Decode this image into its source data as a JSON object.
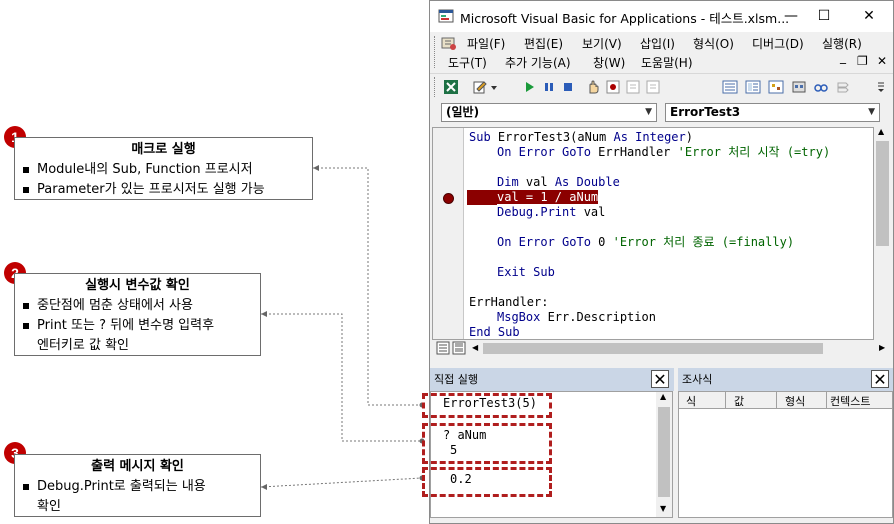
{
  "callouts": [
    {
      "number": "1",
      "title": "매크로 실행",
      "items": [
        "Module내의 Sub, Function 프로시저",
        "Parameter가 있는 프로시저도 실행 가능"
      ]
    },
    {
      "number": "2",
      "title": "실행시 변수값 확인",
      "items": [
        "중단점에 멈춘 상태에서 사용",
        "Print 또는 ? 뒤에 변수명 입력후",
        "엔터키로 값 확인"
      ]
    },
    {
      "number": "3",
      "title": "출력 메시지 확인",
      "items": [
        "Debug.Print로 출력되는 내용",
        "확인"
      ]
    }
  ],
  "window": {
    "title": "Microsoft Visual Basic for Applications - 테스트.xlsm...",
    "minimize": "—",
    "maximize": "☐",
    "close": "✕"
  },
  "menu": {
    "row1": [
      "파일(F)",
      "편집(E)",
      "보기(V)",
      "삽입(I)",
      "형식(O)",
      "디버그(D)",
      "실행(R)"
    ],
    "row2": [
      "도구(T)",
      "추가 기능(A)",
      "창(W)",
      "도움말(H)"
    ],
    "mdi_min": "_",
    "mdi_restore": "❐",
    "mdi_close": "✕"
  },
  "combos": {
    "object": "(일반)",
    "procedure": "ErrorTest3"
  },
  "code_lines": [
    {
      "indent": 0,
      "parts": [
        {
          "t": "Sub ",
          "c": "kw"
        },
        {
          "t": "ErrorTest3(aNum ",
          "c": "plain"
        },
        {
          "t": "As Integer",
          "c": "kw"
        },
        {
          "t": ")",
          "c": "plain"
        }
      ]
    },
    {
      "indent": 1,
      "parts": [
        {
          "t": "On Error GoTo ",
          "c": "kw"
        },
        {
          "t": "ErrHandler ",
          "c": "plain"
        },
        {
          "t": "'Error 처리 시작 (=try)",
          "c": "cm"
        }
      ]
    },
    {
      "indent": 0,
      "parts": []
    },
    {
      "indent": 1,
      "parts": [
        {
          "t": "Dim ",
          "c": "kw"
        },
        {
          "t": "val ",
          "c": "plain"
        },
        {
          "t": "As Double",
          "c": "kw"
        }
      ]
    },
    {
      "indent": 1,
      "breakpoint": true,
      "parts": [
        {
          "t": "val = 1 / aNum",
          "c": "bp"
        }
      ]
    },
    {
      "indent": 1,
      "parts": [
        {
          "t": "Debug.Print ",
          "c": "kw"
        },
        {
          "t": "val",
          "c": "plain"
        }
      ]
    },
    {
      "indent": 0,
      "parts": []
    },
    {
      "indent": 1,
      "parts": [
        {
          "t": "On Error GoTo ",
          "c": "kw"
        },
        {
          "t": "0 ",
          "c": "plain"
        },
        {
          "t": "'Error 처리 종료 (=finally)",
          "c": "cm"
        }
      ]
    },
    {
      "indent": 0,
      "parts": []
    },
    {
      "indent": 1,
      "parts": [
        {
          "t": "Exit Sub",
          "c": "kw"
        }
      ]
    },
    {
      "indent": 0,
      "parts": []
    },
    {
      "indent": 0,
      "parts": [
        {
          "t": "ErrHandler:",
          "c": "plain"
        }
      ]
    },
    {
      "indent": 1,
      "parts": [
        {
          "t": "MsgBox ",
          "c": "kw"
        },
        {
          "t": "Err.Description",
          "c": "plain"
        }
      ]
    },
    {
      "indent": 0,
      "parts": [
        {
          "t": "End Sub",
          "c": "kw"
        }
      ]
    }
  ],
  "immediate": {
    "title": "직접 실행",
    "close": "✕",
    "lines": [
      "ErrorTest3(5)",
      "? aNum",
      "5",
      "0.2"
    ]
  },
  "watch": {
    "title": "조사식",
    "close": "✕",
    "columns": [
      "식",
      "값",
      "형식",
      "컨텍스트"
    ]
  },
  "colors": {
    "badge": "#c00000",
    "dash": "#b01e1e",
    "breakpoint": "#8b0000",
    "keyword": "#00008b",
    "comment": "#006400"
  }
}
